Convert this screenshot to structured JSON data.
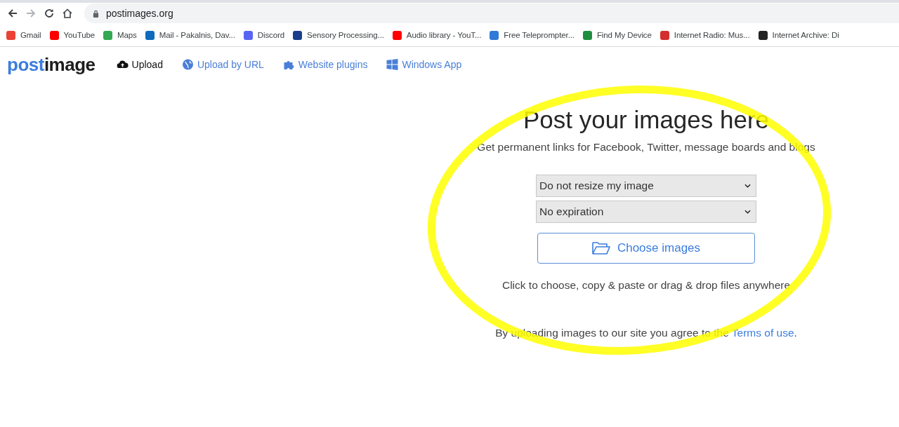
{
  "browser": {
    "nav_buttons": [
      {
        "kind": "back",
        "disabled": false
      },
      {
        "kind": "forward",
        "disabled": true
      },
      {
        "kind": "reload",
        "disabled": false
      },
      {
        "kind": "home",
        "disabled": false
      }
    ],
    "address": "postimages.org",
    "bookmarks": [
      {
        "label": "Gmail",
        "color": "#ea4335"
      },
      {
        "label": "YouTube",
        "color": "#ff0000"
      },
      {
        "label": "Maps",
        "color": "#34a853"
      },
      {
        "label": "Mail - Pakalnis, Dav...",
        "color": "#0f6cbd"
      },
      {
        "label": "Discord",
        "color": "#5865f2"
      },
      {
        "label": "Sensory Processing...",
        "color": "#1a3e8c"
      },
      {
        "label": "Audio library - YouT...",
        "color": "#ff0000"
      },
      {
        "label": "Free Teleprompter...",
        "color": "#2f7bd6"
      },
      {
        "label": "Find My Device",
        "color": "#1e8e3e"
      },
      {
        "label": "Internet Radio: Mus...",
        "color": "#d32f2f"
      },
      {
        "label": "Internet Archive: Di",
        "color": "#222222"
      }
    ]
  },
  "site_nav": {
    "logo": {
      "first": "post",
      "second": "image"
    },
    "links": [
      {
        "kind": "upload",
        "label": "Upload"
      },
      {
        "kind": "url",
        "label": "Upload by URL"
      },
      {
        "kind": "plugins",
        "label": "Website plugins"
      },
      {
        "kind": "windows",
        "label": "Windows App"
      }
    ]
  },
  "main": {
    "title": "Post your images here",
    "subtitle": "Get permanent links for Facebook, Twitter, message boards and blogs",
    "resize_select": "Do not resize my image",
    "expiration_select": "No expiration",
    "choose_button": "Choose images",
    "hint": "Click to choose, copy & paste or drag & drop files anywhere",
    "terms_text": "By uploading images to our site you agree to the",
    "terms_link": "Terms of use",
    "terms_end": "."
  }
}
